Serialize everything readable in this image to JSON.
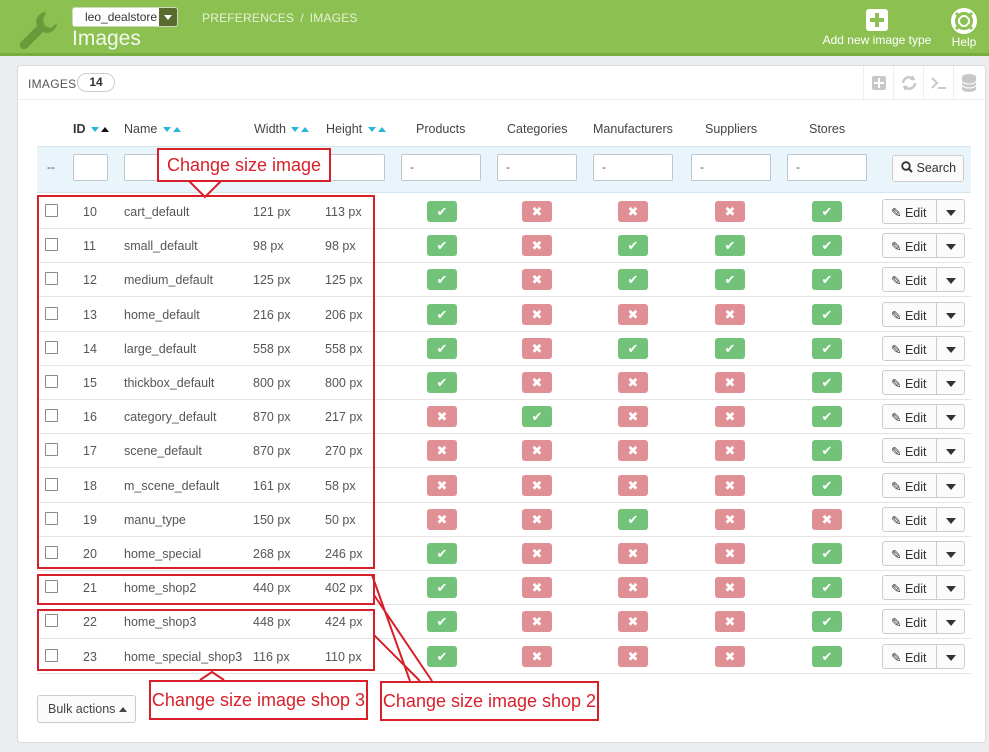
{
  "header": {
    "shop_name": "leo_dealstore",
    "breadcrumb": [
      "PREFERENCES",
      "IMAGES"
    ],
    "breadcrumb_sep": "/",
    "title": "Images",
    "add_label": "Add new image type",
    "help_label": "Help",
    "colors": {
      "bar": "#8cc152",
      "accent": "#25b9d7"
    }
  },
  "panel": {
    "title": "IMAGES",
    "count": "14"
  },
  "columns": {
    "id": "ID",
    "name": "Name",
    "width": "Width",
    "height": "Height",
    "products": "Products",
    "categories": "Categories",
    "manufacturers": "Manufacturers",
    "suppliers": "Suppliers",
    "stores": "Stores"
  },
  "filters": {
    "dash": "--",
    "products": "-",
    "categories": "-",
    "manufacturers": "-",
    "suppliers": "-",
    "stores": "-",
    "search_label": "Search"
  },
  "rows": [
    {
      "id": "10",
      "name": "cart_default",
      "width": "121 px",
      "height": "113 px",
      "products": true,
      "categories": false,
      "manufacturers": false,
      "suppliers": false,
      "stores": true
    },
    {
      "id": "11",
      "name": "small_default",
      "width": "98 px",
      "height": "98 px",
      "products": true,
      "categories": false,
      "manufacturers": true,
      "suppliers": true,
      "stores": true
    },
    {
      "id": "12",
      "name": "medium_default",
      "width": "125 px",
      "height": "125 px",
      "products": true,
      "categories": false,
      "manufacturers": true,
      "suppliers": true,
      "stores": true
    },
    {
      "id": "13",
      "name": "home_default",
      "width": "216 px",
      "height": "206 px",
      "products": true,
      "categories": false,
      "manufacturers": false,
      "suppliers": false,
      "stores": true
    },
    {
      "id": "14",
      "name": "large_default",
      "width": "558 px",
      "height": "558 px",
      "products": true,
      "categories": false,
      "manufacturers": true,
      "suppliers": true,
      "stores": true
    },
    {
      "id": "15",
      "name": "thickbox_default",
      "width": "800 px",
      "height": "800 px",
      "products": true,
      "categories": false,
      "manufacturers": false,
      "suppliers": false,
      "stores": true
    },
    {
      "id": "16",
      "name": "category_default",
      "width": "870 px",
      "height": "217 px",
      "products": false,
      "categories": true,
      "manufacturers": false,
      "suppliers": false,
      "stores": true
    },
    {
      "id": "17",
      "name": "scene_default",
      "width": "870 px",
      "height": "270 px",
      "products": false,
      "categories": false,
      "manufacturers": false,
      "suppliers": false,
      "stores": true
    },
    {
      "id": "18",
      "name": "m_scene_default",
      "width": "161 px",
      "height": "58 px",
      "products": false,
      "categories": false,
      "manufacturers": false,
      "suppliers": false,
      "stores": true
    },
    {
      "id": "19",
      "name": "manu_type",
      "width": "150 px",
      "height": "50 px",
      "products": false,
      "categories": false,
      "manufacturers": true,
      "suppliers": false,
      "stores": false
    },
    {
      "id": "20",
      "name": "home_special",
      "width": "268 px",
      "height": "246 px",
      "products": true,
      "categories": false,
      "manufacturers": false,
      "suppliers": false,
      "stores": true
    },
    {
      "id": "21",
      "name": "home_shop2",
      "width": "440 px",
      "height": "402 px",
      "products": true,
      "categories": false,
      "manufacturers": false,
      "suppliers": false,
      "stores": true
    },
    {
      "id": "22",
      "name": "home_shop3",
      "width": "448 px",
      "height": "424 px",
      "products": true,
      "categories": false,
      "manufacturers": false,
      "suppliers": false,
      "stores": true
    },
    {
      "id": "23",
      "name": "home_special_shop3",
      "width": "116 px",
      "height": "110 px",
      "products": true,
      "categories": false,
      "manufacturers": false,
      "suppliers": false,
      "stores": true
    }
  ],
  "row_actions": {
    "edit_label": "Edit"
  },
  "bulk_actions_label": "Bulk actions",
  "annotations": {
    "change_size": "Change size image",
    "shop3": "Change size image shop 3",
    "shop2": "Change size image shop 2"
  }
}
